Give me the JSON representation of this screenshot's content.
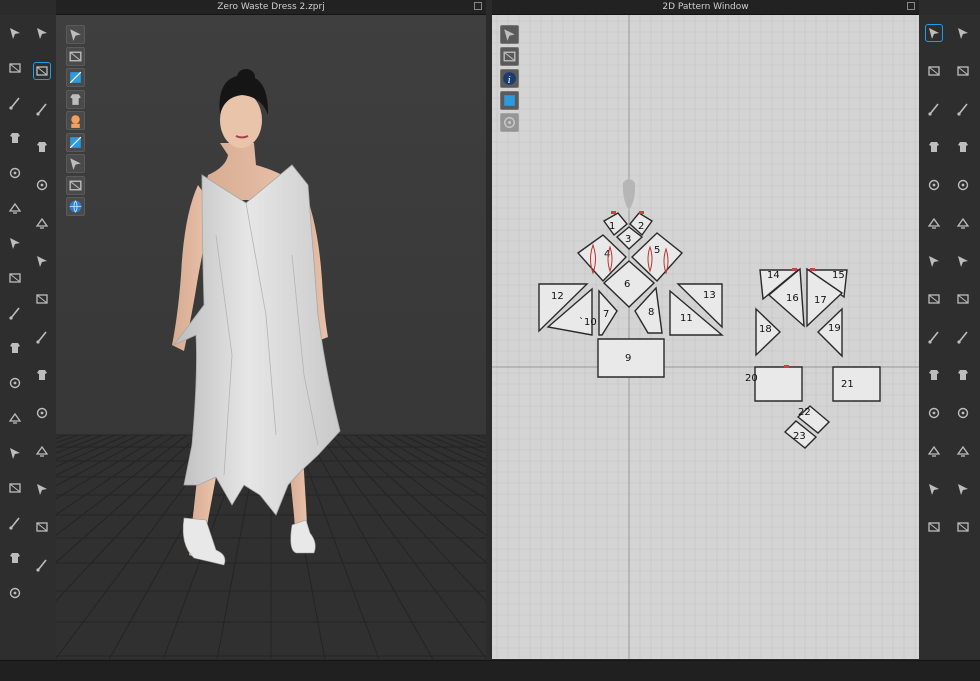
{
  "window3d": {
    "title": "Zero Waste Dress 2.zprj"
  },
  "window2d": {
    "title": "2D Pattern Window"
  },
  "pattern_pieces": [
    "1",
    "2",
    "3",
    "4",
    "5",
    "6",
    "7",
    "8",
    "9",
    "`10",
    "11",
    "12",
    "13",
    "14",
    "15",
    "16",
    "17",
    "18",
    "19",
    "20",
    "21",
    "22",
    "23"
  ],
  "colors": {
    "viewport3d": "#3d3d3d",
    "pattern_bg": "#d4d4d4",
    "toolbar": "#2e2e2e",
    "accent_blue": "#1aa0e8"
  },
  "icons": {
    "left_toolbar_col1": [
      "select-move-icon",
      "transform-icon",
      "edit-fabric-icon",
      "tack-icon",
      "pin-icon",
      "fold-arrangement-icon",
      "strengthen-icon",
      "measure-icon",
      "avatar-size-icon",
      "shirt-icon",
      "book-icon",
      "pin-edit-icon",
      "figure-icon",
      "stitch-icon",
      "brush-icon",
      "garment-icon",
      "garment-alt-icon"
    ],
    "left_toolbar_col2": [
      "walk-avatar-icon",
      "move-point-icon",
      "magnet-icon",
      "scissors-icon",
      "snap-icon",
      "shape-icon",
      "settings-icon",
      "button-icon",
      "buttonhole-icon",
      "zip-icon",
      "group-icon",
      "cube-icon",
      "plane-icon",
      "texture-icon",
      "flip-icon"
    ],
    "view3d_toolbar": [
      "mesh-icon",
      "avatar-display-icon",
      "garment-display-icon",
      "xray-icon",
      "body-icon",
      "texture-display-icon",
      "wireframe-icon",
      "skin-icon",
      "globe-icon"
    ],
    "view2d_toolbar": [
      "eye-pen-icon",
      "eye-shirt-icon",
      "info-icon",
      "fabric-icon",
      "lock-icon"
    ],
    "right_toolbar_col1": [
      "select-pattern-icon",
      "edit-curve-icon",
      "polygon-icon",
      "rectangle-icon",
      "internal-polygon-icon",
      "dart-icon",
      "trace-icon",
      "segment-icon",
      "sewing-icon",
      "ruler-icon",
      "text-icon",
      "text-alt-icon",
      "grid-icon",
      "avatar-pose-icon"
    ],
    "right_toolbar_col2": [
      "transform-pattern-icon",
      "add-point-icon",
      "curve-point-icon",
      "edit-pattern-icon",
      "gather-icon",
      "fold-icon",
      "pleat-icon",
      "free-seam-icon",
      "elastic-icon",
      "measure-length-icon",
      "notch-icon",
      "grading-icon",
      "snap-grid-icon",
      "fabric-grain-icon"
    ]
  }
}
